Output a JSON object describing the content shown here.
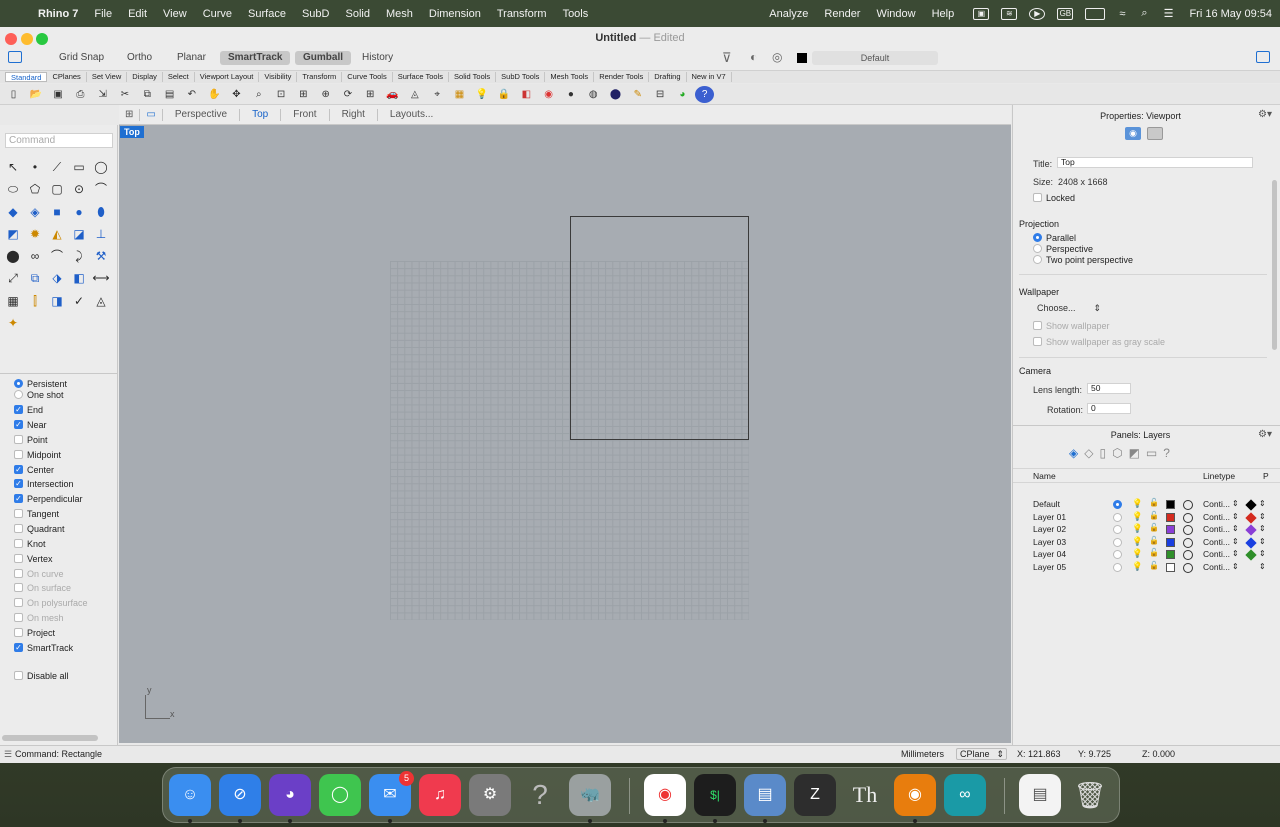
{
  "menubar": {
    "app": "Rhino 7",
    "items": [
      "File",
      "Edit",
      "View",
      "Curve",
      "Surface",
      "SubD",
      "Solid",
      "Mesh",
      "Dimension",
      "Transform",
      "Tools"
    ],
    "right_items": [
      "Analyze",
      "Render",
      "Window",
      "Help"
    ],
    "input_source": "GB",
    "clock": "Fri 16 May  09:54"
  },
  "window": {
    "title": "Untitled",
    "title_sep": "—",
    "edited": "Edited",
    "toggles": [
      {
        "label": "Grid Snap",
        "on": false
      },
      {
        "label": "Ortho",
        "on": false
      },
      {
        "label": "Planar",
        "on": false
      },
      {
        "label": "SmartTrack",
        "on": true
      },
      {
        "label": "Gumball",
        "on": true
      },
      {
        "label": "History",
        "on": false
      }
    ],
    "layer_display": "Default"
  },
  "tabs": [
    "Standard",
    "CPlanes",
    "Set View",
    "Display",
    "Select",
    "Viewport Layout",
    "Visibility",
    "Transform",
    "Curve Tools",
    "Surface Tools",
    "Solid Tools",
    "SubD Tools",
    "Mesh Tools",
    "Render Tools",
    "Drafting",
    "New in V7"
  ],
  "toolbar_icons": [
    "new-icon",
    "open-icon",
    "save-icon",
    "print-icon",
    "import-icon",
    "cut-icon",
    "copy-icon",
    "paste-icon",
    "undo-icon",
    "pan-icon",
    "move-icon",
    "zoom-icon",
    "zoom-window-icon",
    "zoom-extents-icon",
    "zoom-selected-icon",
    "rotate-view-icon",
    "four-view-icon",
    "car-icon",
    "mesh-icon",
    "grid-icon",
    "hatch-icon",
    "lightbulb-icon",
    "lock-icon",
    "shade-icon",
    "color-wheel-icon",
    "sphere-icon",
    "render-icon",
    "render-sphere-icon",
    "filter-icon",
    "layout-icon",
    "globe-icon",
    "help-icon"
  ],
  "command": {
    "placeholder": "Command"
  },
  "viewport_tabs": [
    "Perspective",
    "Top",
    "Front",
    "Right",
    "Layouts..."
  ],
  "active_viewport": "Top",
  "axis": {
    "x": "x",
    "y": "y"
  },
  "osnaps": [
    {
      "label": "Persistent",
      "type": "radio",
      "on": true,
      "enabled": true
    },
    {
      "label": "One shot",
      "type": "radio",
      "on": false,
      "enabled": true
    },
    {
      "label": "End",
      "type": "check",
      "on": true,
      "enabled": true
    },
    {
      "label": "Near",
      "type": "check",
      "on": true,
      "enabled": true
    },
    {
      "label": "Point",
      "type": "check",
      "on": false,
      "enabled": true
    },
    {
      "label": "Midpoint",
      "type": "check",
      "on": false,
      "enabled": true
    },
    {
      "label": "Center",
      "type": "check",
      "on": true,
      "enabled": true
    },
    {
      "label": "Intersection",
      "type": "check",
      "on": true,
      "enabled": true
    },
    {
      "label": "Perpendicular",
      "type": "check",
      "on": true,
      "enabled": true
    },
    {
      "label": "Tangent",
      "type": "check",
      "on": false,
      "enabled": true
    },
    {
      "label": "Quadrant",
      "type": "check",
      "on": false,
      "enabled": true
    },
    {
      "label": "Knot",
      "type": "check",
      "on": false,
      "enabled": true
    },
    {
      "label": "Vertex",
      "type": "check",
      "on": false,
      "enabled": true
    },
    {
      "label": "On curve",
      "type": "check",
      "on": false,
      "enabled": false
    },
    {
      "label": "On surface",
      "type": "check",
      "on": false,
      "enabled": false
    },
    {
      "label": "On polysurface",
      "type": "check",
      "on": false,
      "enabled": false
    },
    {
      "label": "On mesh",
      "type": "check",
      "on": false,
      "enabled": false
    },
    {
      "label": "Project",
      "type": "check",
      "on": false,
      "enabled": true
    },
    {
      "label": "SmartTrack",
      "type": "check",
      "on": true,
      "enabled": true
    }
  ],
  "disable_all": "Disable all",
  "properties": {
    "header": "Properties: Viewport",
    "title_label": "Title:",
    "title_value": "Top",
    "size_label": "Size:",
    "size_value": "2408 x 1668",
    "locked": "Locked",
    "projection": "Projection",
    "projection_options": [
      "Parallel",
      "Perspective",
      "Two point perspective"
    ],
    "projection_selected": 0,
    "wallpaper": "Wallpaper",
    "wallpaper_choose": "Choose...",
    "show_wallpaper": "Show wallpaper",
    "show_gray": "Show wallpaper as gray scale",
    "camera": "Camera",
    "lens_label": "Lens length:",
    "lens_value": "50",
    "rotation_label": "Rotation:",
    "rotation_value": "0"
  },
  "layers": {
    "header": "Panels: Layers",
    "col_name": "Name",
    "col_linetype": "Linetype",
    "col_p": "P",
    "rows": [
      {
        "name": "Default",
        "color": "#000000",
        "linetype": "Conti...",
        "current": true
      },
      {
        "name": "Layer 01",
        "color": "#d42a1e",
        "linetype": "Conti...",
        "current": false
      },
      {
        "name": "Layer 02",
        "color": "#8a3fd6",
        "linetype": "Conti...",
        "current": false
      },
      {
        "name": "Layer 03",
        "color": "#1a3fe0",
        "linetype": "Conti...",
        "current": false
      },
      {
        "name": "Layer 04",
        "color": "#2f8f2a",
        "linetype": "Conti...",
        "current": false
      },
      {
        "name": "Layer 05",
        "color": "#ffffff",
        "linetype": "Conti...",
        "current": false
      }
    ]
  },
  "status": {
    "command": "Command: Rectangle",
    "units": "Millimeters",
    "cplane": "CPlane",
    "x": "X: 121.863",
    "y": "Y: 9.725",
    "z": "Z: 0.000"
  },
  "dock": {
    "apps": [
      "Finder",
      "Safari",
      "Firefox",
      "Messages",
      "Mail",
      "Music",
      "System Settings",
      "Help",
      "Rhino",
      "Chrome",
      "Terminal",
      "Preview",
      "Sublime Text",
      "Typora",
      "Blender",
      "Arduino",
      "Documents",
      "Trash"
    ],
    "mail_badge": "5"
  }
}
